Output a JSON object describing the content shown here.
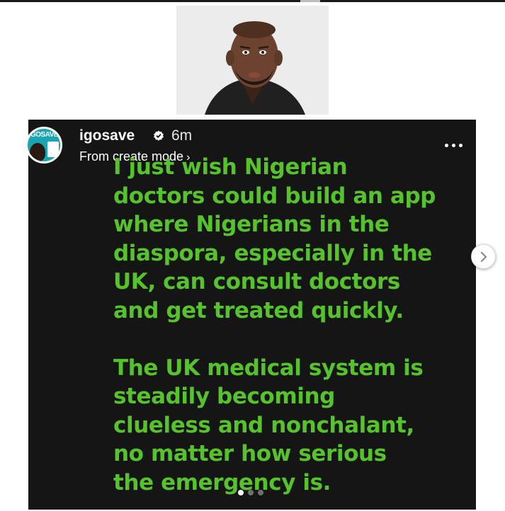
{
  "article": {
    "portrait_alt": "Man in dark shirt speaking"
  },
  "post": {
    "username": "igosave",
    "time_ago": "6m",
    "mode_link": "From create mode",
    "verified_color": "#ffffff",
    "text_color": "#56c22c",
    "background_color": "#151515",
    "paragraph1": [
      "I just wish Nigerian",
      "doctors could build an app",
      "where Nigerians in the",
      "diaspora, especially in the",
      "UK, can consult doctors",
      "and get treated quickly."
    ],
    "paragraph2": [
      "The UK medical system is",
      "steadily becoming",
      "clueless and nonchalant,",
      "no matter how serious",
      "the emergency is."
    ],
    "carousel": {
      "total": 3,
      "active": 1
    },
    "avatar_brand": "GOSAVE"
  },
  "icons": {
    "verified": "verified-badge-icon",
    "more": "more-options-icon",
    "next": "chevron-right-icon"
  }
}
